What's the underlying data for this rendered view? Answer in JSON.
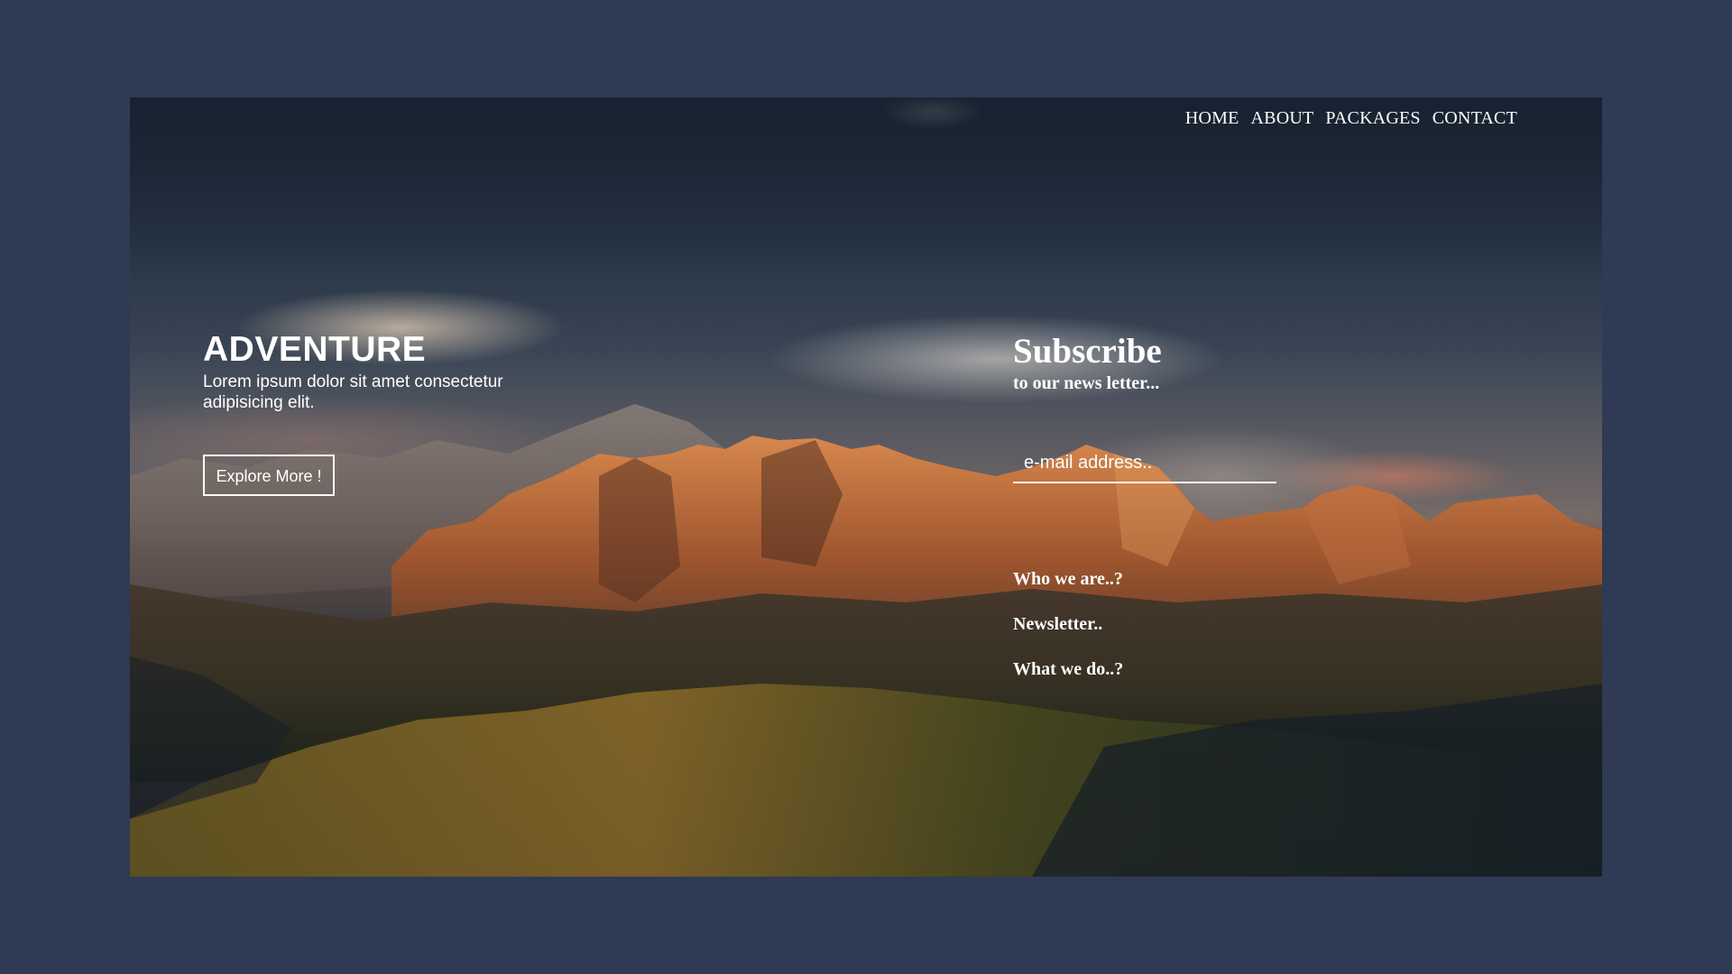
{
  "nav": {
    "items": [
      {
        "label": "HOME"
      },
      {
        "label": "ABOUT"
      },
      {
        "label": "PACKAGES"
      },
      {
        "label": "CONTACT"
      }
    ]
  },
  "hero": {
    "title": "ADVENTURE",
    "description": "Lorem ipsum dolor sit amet consectetur adipisicing elit.",
    "cta_label": "Explore More !"
  },
  "subscribe": {
    "title": "Subscribe",
    "subtitle": "to our news letter...",
    "email_placeholder": "e-mail address..",
    "links": [
      {
        "label": "Who we are..?"
      },
      {
        "label": "Newsletter.."
      },
      {
        "label": "What we do..?"
      }
    ]
  },
  "colors": {
    "page_background": "#2f3a54",
    "text": "#ffffff"
  }
}
